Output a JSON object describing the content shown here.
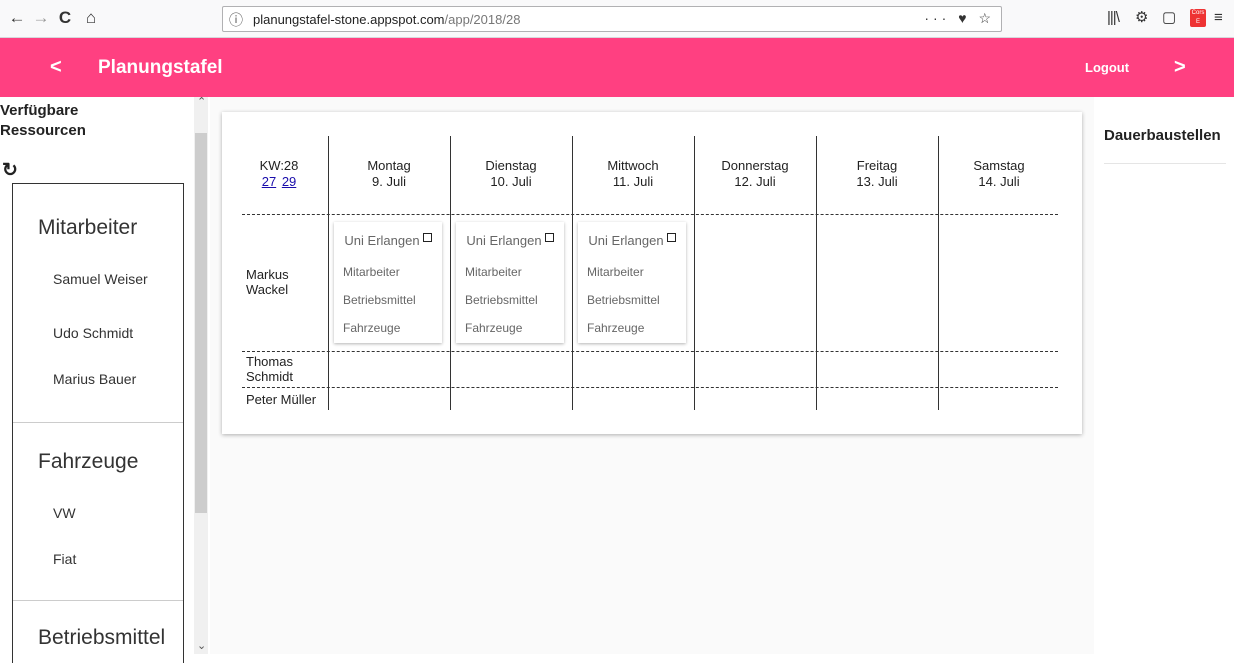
{
  "browser": {
    "back": "←",
    "forward": "→",
    "reload": "C",
    "home": "⌂",
    "url_host": "planungstafel-stone.appspot.com",
    "url_path": "/app/2018/28",
    "url_actions": "··· ♥ ☆",
    "library_icon": "|||\\",
    "cors_label": "Cors E"
  },
  "header": {
    "back_label": "<",
    "title": "Planungstafel",
    "logout_label": "Logout",
    "forward_label": ">",
    "color": "#ff4081"
  },
  "sidebar": {
    "title": "Verfügbare Ressourcen",
    "sections": [
      {
        "title": "Mitarbeiter",
        "items": [
          "Samuel Weiser",
          "Udo Schmidt",
          "Marius Bauer"
        ]
      },
      {
        "title": "Fahrzeuge",
        "items": [
          "VW",
          "Fiat"
        ]
      },
      {
        "title": "Betriebsmittel",
        "items": []
      }
    ]
  },
  "board": {
    "kw_label": "KW:28",
    "kw_prev": "27",
    "kw_next": "29",
    "days": [
      {
        "name": "Montag",
        "date": "9. Juli"
      },
      {
        "name": "Dienstag",
        "date": "10. Juli"
      },
      {
        "name": "Mittwoch",
        "date": "11. Juli"
      },
      {
        "name": "Donnerstag",
        "date": "12. Juli"
      },
      {
        "name": "Freitag",
        "date": "13. Juli"
      },
      {
        "name": "Samstag",
        "date": "14. Juli"
      }
    ],
    "rows": [
      {
        "name": "Markus Wackel"
      },
      {
        "name": "Thomas Schmidt"
      },
      {
        "name": "Peter Müller"
      }
    ],
    "jobs": [
      {
        "title": "Uni Erlangen",
        "lines": [
          "Mitarbeiter",
          "Betriebsmittel",
          "Fahrzeuge"
        ]
      },
      {
        "title": "Uni Erlangen",
        "lines": [
          "Mitarbeiter",
          "Betriebsmittel",
          "Fahrzeuge"
        ]
      },
      {
        "title": "Uni Erlangen",
        "lines": [
          "Mitarbeiter",
          "Betriebsmittel",
          "Fahrzeuge"
        ]
      }
    ]
  },
  "right_panel": {
    "title": "Dauerbaustellen"
  }
}
